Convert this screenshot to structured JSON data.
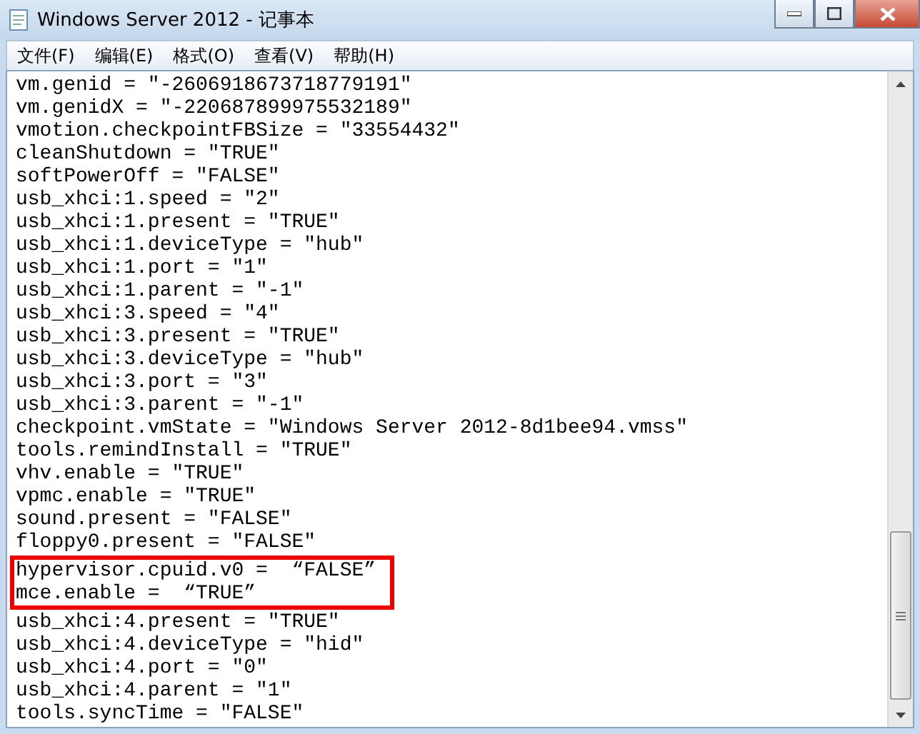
{
  "window": {
    "title": "Windows Server 2012 - 记事本"
  },
  "menu": [
    "文件(F)",
    "编辑(E)",
    "格式(O)",
    "查看(V)",
    "帮助(H)"
  ],
  "lines": [
    {
      "text": "vm.genid = \"-2606918673718779191\"",
      "highlighted": false
    },
    {
      "text": "vm.genidX = \"-220687899975532189\"",
      "highlighted": false
    },
    {
      "text": "vmotion.checkpointFBSize = \"33554432\"",
      "highlighted": false
    },
    {
      "text": "cleanShutdown = \"TRUE\"",
      "highlighted": false
    },
    {
      "text": "softPowerOff = \"FALSE\"",
      "highlighted": false
    },
    {
      "text": "usb_xhci:1.speed = \"2\"",
      "highlighted": false
    },
    {
      "text": "usb_xhci:1.present = \"TRUE\"",
      "highlighted": false
    },
    {
      "text": "usb_xhci:1.deviceType = \"hub\"",
      "highlighted": false
    },
    {
      "text": "usb_xhci:1.port = \"1\"",
      "highlighted": false
    },
    {
      "text": "usb_xhci:1.parent = \"-1\"",
      "highlighted": false
    },
    {
      "text": "usb_xhci:3.speed = \"4\"",
      "highlighted": false
    },
    {
      "text": "usb_xhci:3.present = \"TRUE\"",
      "highlighted": false
    },
    {
      "text": "usb_xhci:3.deviceType = \"hub\"",
      "highlighted": false
    },
    {
      "text": "usb_xhci:3.port = \"3\"",
      "highlighted": false
    },
    {
      "text": "usb_xhci:3.parent = \"-1\"",
      "highlighted": false
    },
    {
      "text": "checkpoint.vmState = \"Windows Server 2012-8d1bee94.vmss\"",
      "highlighted": false
    },
    {
      "text": "tools.remindInstall = \"TRUE\"",
      "highlighted": false
    },
    {
      "text": "vhv.enable = \"TRUE\"",
      "highlighted": false
    },
    {
      "text": "vpmc.enable = \"TRUE\"",
      "highlighted": false
    },
    {
      "text": "sound.present = \"FALSE\"",
      "highlighted": false
    },
    {
      "text": "floppy0.present = \"FALSE\"",
      "highlighted": false
    },
    {
      "text": "hypervisor.cpuid.v0 =  “FALSE”",
      "highlighted": true
    },
    {
      "text": "mce.enable =  “TRUE”",
      "highlighted": true
    },
    {
      "text": "usb_xhci:4.present = \"TRUE\"",
      "highlighted": false
    },
    {
      "text": "usb_xhci:4.deviceType = \"hid\"",
      "highlighted": false
    },
    {
      "text": "usb_xhci:4.port = \"0\"",
      "highlighted": false
    },
    {
      "text": "usb_xhci:4.parent = \"1\"",
      "highlighted": false
    },
    {
      "text": "tools.syncTime = \"FALSE\"",
      "highlighted": false
    }
  ]
}
